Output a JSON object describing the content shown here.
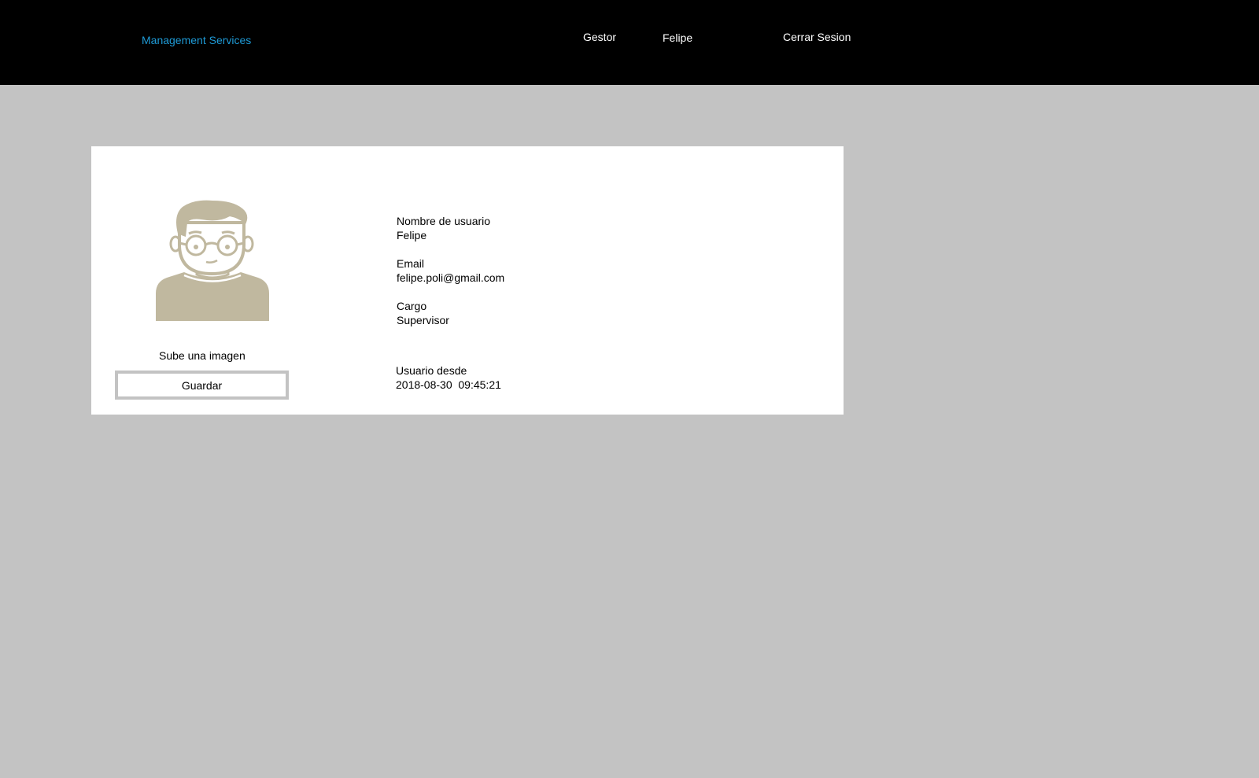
{
  "header": {
    "brand": "Management Services",
    "nav": {
      "gestor": "Gestor",
      "user": "Felipe",
      "logout": "Cerrar Sesion"
    }
  },
  "profile": {
    "avatar_icon": "user-avatar-icon",
    "upload_label": "Sube una imagen",
    "save_label": "Guardar",
    "fields": {
      "username": {
        "label": "Nombre de usuario",
        "value": "Felipe"
      },
      "email": {
        "label": "Email",
        "value": "felipe.poli@gmail.com"
      },
      "cargo": {
        "label": "Cargo",
        "value": "Supervisor"
      },
      "since": {
        "label": "Usuario desde",
        "value": "2018-08-30  09:45:21"
      }
    }
  },
  "colors": {
    "background": "#c3c3c3",
    "header": "#000000",
    "brand": "#1e9ad6",
    "avatar": "#c0b89f"
  }
}
